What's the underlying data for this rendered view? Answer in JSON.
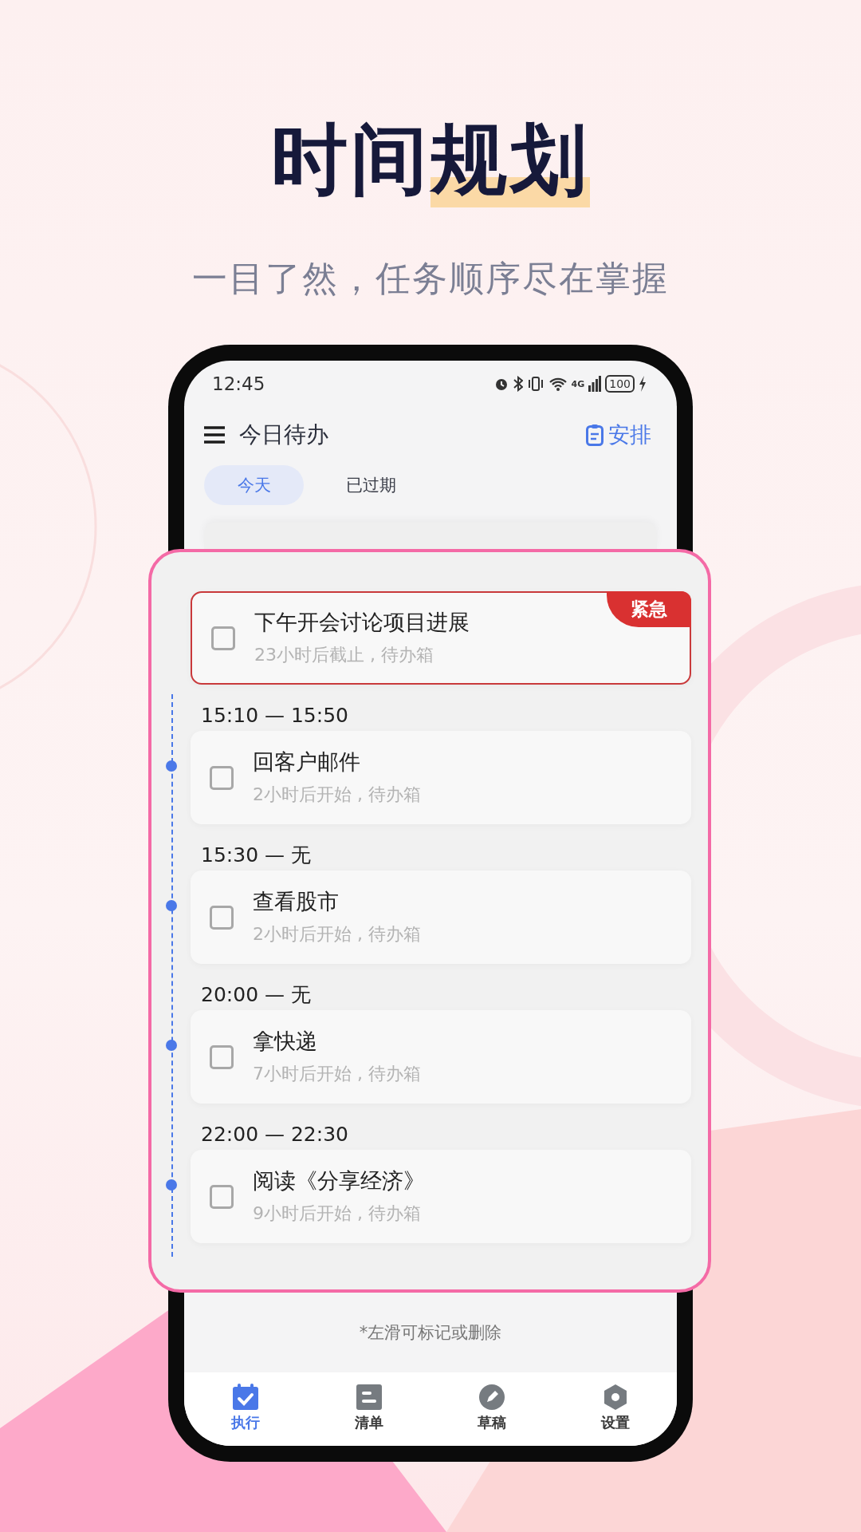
{
  "headline": {
    "parts": [
      {
        "text": "时间",
        "highlighted": false
      },
      {
        "text": "规划",
        "highlighted": true
      }
    ]
  },
  "subtitle": "一目了然，任务顺序尽在掌握",
  "status_bar": {
    "time": "12:45",
    "network": "4G",
    "battery": "100"
  },
  "header": {
    "title": "今日待办",
    "action": "安排"
  },
  "tabs": [
    {
      "label": "今天",
      "selected": true
    },
    {
      "label": "已过期",
      "selected": false
    }
  ],
  "tasks": [
    {
      "kind": "urgent",
      "title": "下午开会讨论项目进展",
      "detail": "23小时后截止 , 待办箱",
      "badge": "紧急",
      "checked": false
    },
    {
      "kind": "timed",
      "time": "15:10 — 15:50",
      "title": "回客户邮件",
      "detail": "2小时后开始 , 待办箱",
      "checked": false
    },
    {
      "kind": "timed",
      "time": "15:30 — 无",
      "title": "查看股市",
      "detail": "2小时后开始 , 待办箱",
      "checked": false
    },
    {
      "kind": "timed",
      "time": "20:00 — 无",
      "title": "拿快递",
      "detail": "7小时后开始 , 待办箱",
      "checked": false
    },
    {
      "kind": "timed",
      "time": "22:00 — 22:30",
      "title": "阅读《分享经济》",
      "detail": "9小时后开始 , 待办箱",
      "checked": false
    }
  ],
  "hint": "*左滑可标记或删除",
  "nav": [
    {
      "kind": "execute",
      "label": "执行",
      "selected": true
    },
    {
      "kind": "list",
      "label": "清单",
      "selected": false
    },
    {
      "kind": "draft",
      "label": "草稿",
      "selected": false
    },
    {
      "kind": "settings",
      "label": "设置",
      "selected": false
    }
  ]
}
